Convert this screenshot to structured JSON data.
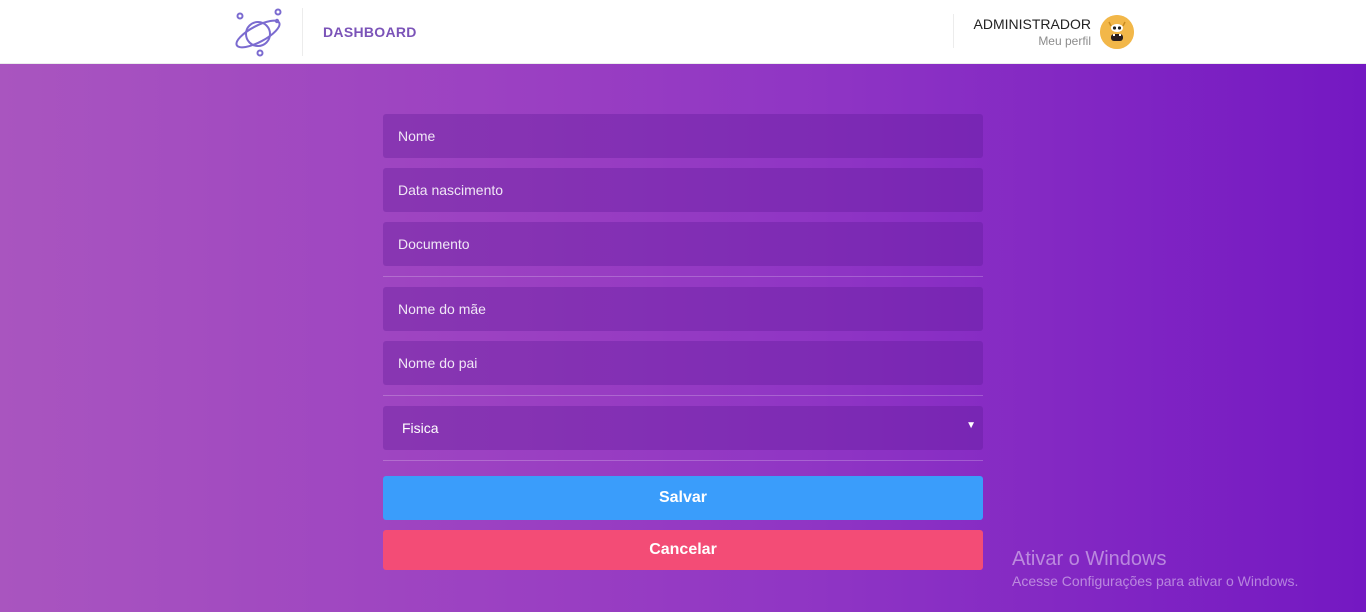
{
  "header": {
    "brand": "DASHBOARD",
    "user_name": "ADMINISTRADOR",
    "user_link": "Meu perfil",
    "logo_icon": "planet-icon",
    "avatar_icon": "monster-avatar-icon"
  },
  "form": {
    "nome_placeholder": "Nome",
    "data_nascimento_placeholder": "Data nascimento",
    "documento_placeholder": "Documento",
    "nome_mae_placeholder": "Nome do mãe",
    "nome_pai_placeholder": "Nome do pai",
    "tipo_pessoa_value": "Fisica",
    "save_label": "Salvar",
    "cancel_label": "Cancelar"
  },
  "watermark": {
    "title": "Ativar o Windows",
    "subtitle": "Acesse Configurações para ativar o Windows."
  },
  "colors": {
    "accent": "#7b53b8",
    "save": "#3a9dfb",
    "cancel": "#f34c76",
    "gradient_start": "#a955bf",
    "gradient_end": "#7418c2"
  }
}
